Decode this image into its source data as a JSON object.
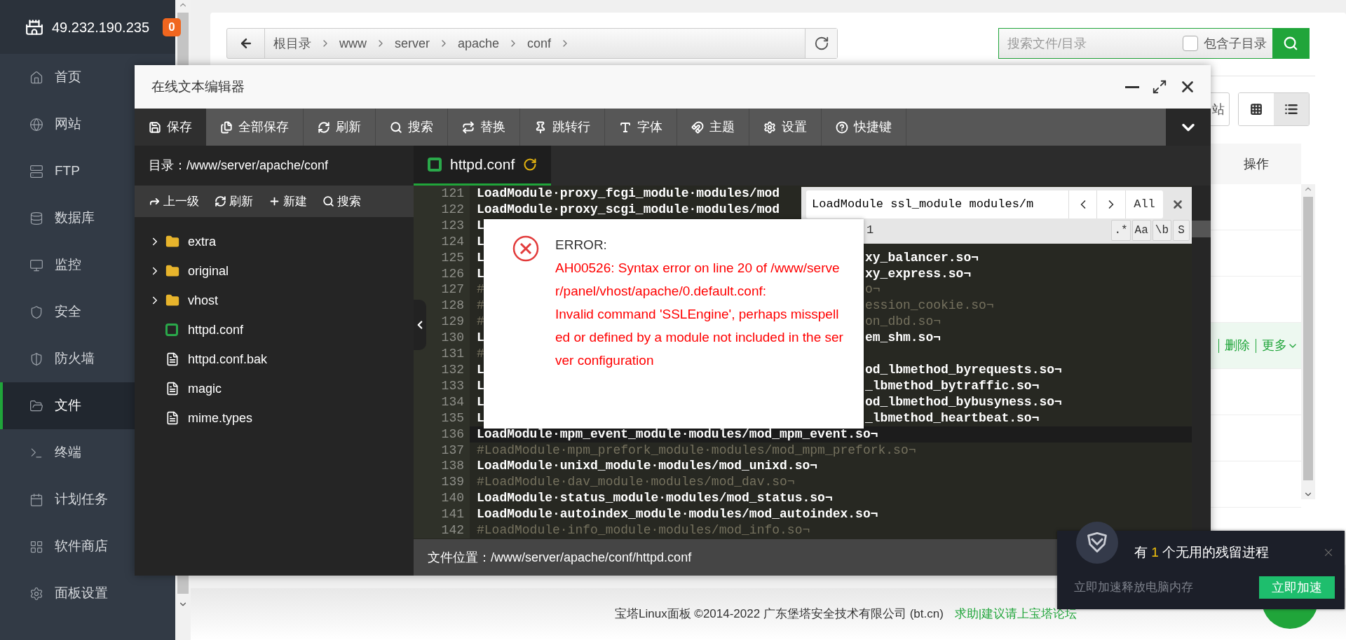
{
  "sidebar": {
    "host": "49.232.190.235",
    "badge": "0",
    "items": [
      {
        "label": "首页",
        "selected": false
      },
      {
        "label": "网站",
        "selected": false
      },
      {
        "label": "FTP",
        "selected": false
      },
      {
        "label": "数据库",
        "selected": false
      },
      {
        "label": "监控",
        "selected": false
      },
      {
        "label": "安全",
        "selected": false
      },
      {
        "label": "防火墙",
        "selected": false
      },
      {
        "label": "文件",
        "selected": true
      },
      {
        "label": "终端",
        "selected": false
      },
      {
        "label": "计划任务",
        "selected": false
      },
      {
        "label": "软件商店",
        "selected": false
      },
      {
        "label": "面板设置",
        "selected": false
      }
    ]
  },
  "breadcrumb": [
    "根目录",
    "www",
    "server",
    "apache",
    "conf"
  ],
  "file_search": {
    "placeholder": "搜索文件/目录",
    "include_subdirs": {
      "label": "包含子目录",
      "checked": false
    }
  },
  "partial_button": "站",
  "view_toggle": [
    {
      "selected": false
    },
    {
      "selected": true
    }
  ],
  "table": {
    "columns": [
      "操作"
    ],
    "rows": [
      {
        "selected": false
      },
      {
        "selected": false
      },
      {
        "selected": false
      },
      {
        "selected": true,
        "actions": [
          "删除",
          "更多"
        ]
      },
      {
        "selected": false
      },
      {
        "selected": false
      },
      {
        "selected": false
      }
    ]
  },
  "editor": {
    "title": "在线文本编辑器",
    "toolbar": [
      {
        "label": "保存",
        "selected": true
      },
      {
        "label": "全部保存",
        "selected": false
      },
      {
        "label": "刷新",
        "selected": false
      },
      {
        "label": "搜索",
        "selected": false
      },
      {
        "label": "替换",
        "selected": false
      },
      {
        "label": "跳转行",
        "selected": false
      },
      {
        "label": "字体",
        "selected": false
      },
      {
        "label": "主题",
        "selected": false
      },
      {
        "label": "设置",
        "selected": false
      },
      {
        "label": "快捷键",
        "selected": false
      }
    ],
    "directory_label": "目录：",
    "directory": "/www/server/apache/conf",
    "file_actions": [
      "上一级",
      "刷新",
      "新建",
      "搜索"
    ],
    "tree": [
      {
        "name": "extra",
        "kind": "folder",
        "expanded": false
      },
      {
        "name": "original",
        "kind": "folder",
        "expanded": false
      },
      {
        "name": "vhost",
        "kind": "folder",
        "expanded": false
      },
      {
        "name": "httpd.conf",
        "kind": "config"
      },
      {
        "name": "httpd.conf.bak",
        "kind": "file"
      },
      {
        "name": "magic",
        "kind": "file"
      },
      {
        "name": "mime.types",
        "kind": "file"
      }
    ],
    "tabs": [
      {
        "name": "httpd.conf",
        "selected": true
      }
    ],
    "lines": [
      {
        "number": "121",
        "text": "LoadModule·proxy_fcgi_module·modules/mod",
        "kind": "code",
        "active": false
      },
      {
        "number": "122",
        "text": "LoadModule·proxy_scgi_module·modules/mod",
        "kind": "code",
        "active": false
      },
      {
        "number": "123",
        "text": "L",
        "kind": "code",
        "active": false
      },
      {
        "number": "124",
        "text": "L",
        "kind": "code",
        "active": false
      },
      {
        "number": "125",
        "text": "L",
        "tail": "xy_balancer.so¬",
        "kind": "code",
        "active": false
      },
      {
        "number": "126",
        "text": "L",
        "tail": "xy_express.so¬",
        "kind": "code",
        "active": false
      },
      {
        "number": "127",
        "text": "#",
        "tail": "o¬",
        "kind": "comment",
        "active": false
      },
      {
        "number": "128",
        "text": "#",
        "tail": "ession_cookie.so¬",
        "kind": "comment",
        "active": false
      },
      {
        "number": "129",
        "text": "#",
        "tail": "on_dbd.so¬",
        "kind": "comment",
        "active": false
      },
      {
        "number": "130",
        "text": "L",
        "tail": "em_shm.so¬",
        "kind": "code",
        "active": false
      },
      {
        "number": "131",
        "text": "#",
        "kind": "comment",
        "active": false
      },
      {
        "number": "132",
        "text": "L",
        "tail": "od_lbmethod_byrequests.so¬",
        "kind": "code",
        "active": false
      },
      {
        "number": "133",
        "text": "L",
        "tail": "_lbmethod_bytraffic.so¬",
        "kind": "code",
        "active": false
      },
      {
        "number": "134",
        "text": "L",
        "tail": "od_lbmethod_bybusyness.so¬",
        "kind": "code",
        "active": false
      },
      {
        "number": "135",
        "text": "L",
        "tail": "_lbmethod_heartbeat.so¬",
        "kind": "code",
        "active": false
      },
      {
        "number": "136",
        "text": "LoadModule·mpm_event_module·modules/mod_mpm_event.so¬",
        "kind": "code",
        "active": true
      },
      {
        "number": "137",
        "text": "#LoadModule·mpm_prefork_module·modules/mod_mpm_prefork.so¬",
        "kind": "comment",
        "active": false
      },
      {
        "number": "138",
        "text": "LoadModule·unixd_module·modules/mod_unixd.so¬",
        "kind": "code",
        "active": false
      },
      {
        "number": "139",
        "text": "#LoadModule·dav_module·modules/mod_dav.so¬",
        "kind": "comment",
        "active": false
      },
      {
        "number": "140",
        "text": "LoadModule·status_module·modules/mod_status.so¬",
        "kind": "code",
        "active": false
      },
      {
        "number": "141",
        "text": "LoadModule·autoindex_module·modules/mod_autoindex.so¬",
        "kind": "code",
        "active": false
      },
      {
        "number": "142",
        "text": "#LoadModule·info_module·modules/mod_info.so¬",
        "kind": "comment",
        "active": false
      }
    ],
    "find": {
      "value": "LoadModule ssl_module modules/m",
      "all": "All",
      "count": "1",
      "options": [
        ".*",
        "Aa",
        "\\b",
        "S"
      ]
    },
    "status_label": "文件位置：",
    "status_path": "/www/server/apache/conf/httpd.conf"
  },
  "error_dialog": {
    "title": "ERROR:",
    "messages": [
      "AH00526: Syntax error on line 20 of /www/server/panel/vhost/apache/0.default.conf:",
      "Invalid command 'SSLEngine', perhaps misspelled or defined by a module not included in the server configuration"
    ]
  },
  "toast": {
    "before": "有",
    "count": "1",
    "after": "个无用的残留进程",
    "subtitle": "立即加速释放电脑内存",
    "button": "立即加速"
  },
  "footer": {
    "copyright": "宝塔Linux面板 ©2014-2022 广东堡塔安全技术有限公司 (bt.cn)",
    "link": "求助|建议请上宝塔论坛"
  }
}
